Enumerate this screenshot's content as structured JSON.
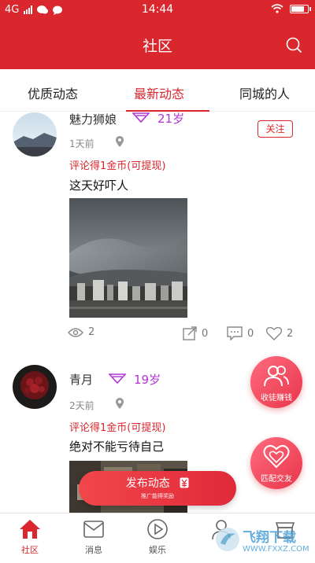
{
  "status": {
    "network": "4G",
    "time": "14:44"
  },
  "header": {
    "title": "社区",
    "search_icon": "search-icon"
  },
  "tabs": [
    {
      "label": "优质动态",
      "active": false
    },
    {
      "label": "最新动态",
      "active": true
    },
    {
      "label": "同城的人",
      "active": false
    }
  ],
  "posts": [
    {
      "username": "魅力狮娘",
      "age": "21岁",
      "time": "1天前",
      "reward": "评论得1金币(可提现)",
      "content": "这天好吓人",
      "follow_label": "关注",
      "views": "2",
      "shares": "0",
      "comments": "0",
      "likes": "2"
    },
    {
      "username": "青月",
      "age": "19岁",
      "time": "2天前",
      "reward": "评论得1金币(可提现)",
      "content": "绝对不能亏待自己"
    }
  ],
  "fabs": {
    "invite_label": "收徒赚钱",
    "match_label": "匹配交友"
  },
  "publish": {
    "label": "发布动态",
    "sub_label": "推广能得奖励"
  },
  "bottom_nav": [
    {
      "label": "社区",
      "active": true
    },
    {
      "label": "消息",
      "active": false
    },
    {
      "label": "娱乐",
      "active": false
    }
  ],
  "watermark": {
    "text": "飞翔下载",
    "url": "WWW.FXXZ.COM"
  },
  "colors": {
    "primary": "#d9272d",
    "age": "#b135d6"
  }
}
